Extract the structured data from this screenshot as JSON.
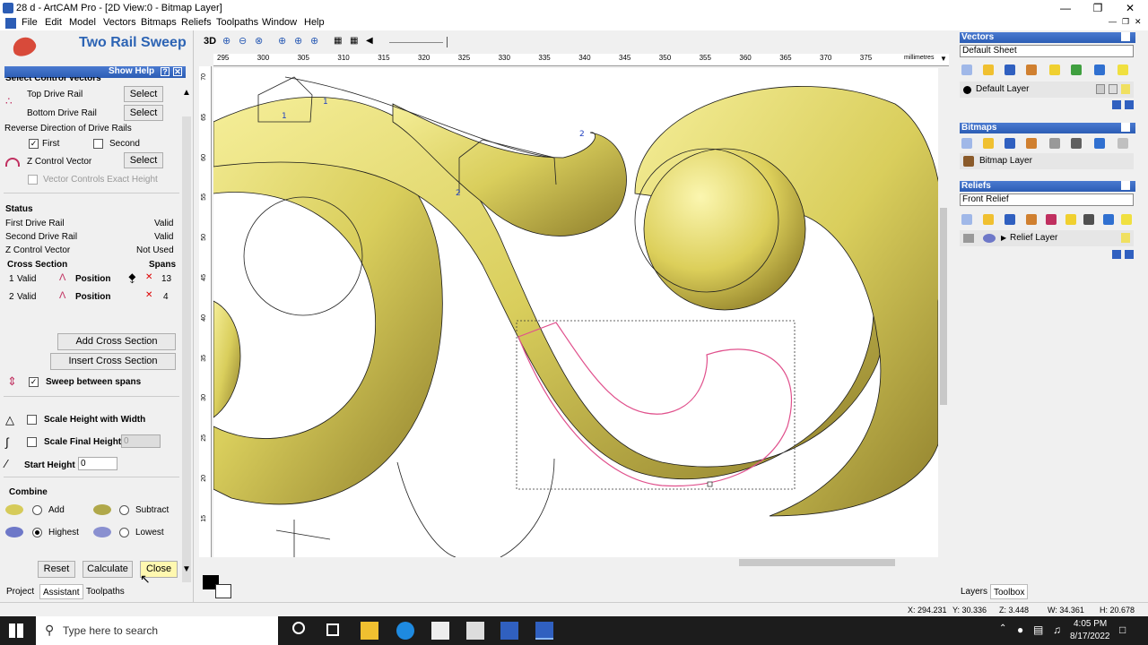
{
  "window": {
    "title": "28 d - ArtCAM Pro - [2D View:0 - Bitmap Layer]"
  },
  "menu": [
    "File",
    "Edit",
    "Model",
    "Vectors",
    "Bitmaps",
    "Reliefs",
    "Toolpaths",
    "Window",
    "Help"
  ],
  "left_panel": {
    "title": "Two Rail Sweep",
    "show_help": "Show Help",
    "section_cut": "Select Control Vectors",
    "top_drive_rail": "Top Drive Rail",
    "bottom_drive_rail": "Bottom Drive Rail",
    "select_label": "Select",
    "reverse_direction": "Reverse Direction of Drive Rails",
    "first": "First",
    "second": "Second",
    "z_control_vector": "Z Control Vector",
    "vector_controls_height": "Vector Controls Exact Height",
    "status_heading": "Status",
    "status_rows": [
      {
        "label": "First Drive Rail",
        "value": "Valid"
      },
      {
        "label": "Second Drive Rail",
        "value": "Valid"
      },
      {
        "label": "Z Control Vector",
        "value": "Not Used"
      }
    ],
    "cross_section": "Cross Section",
    "spans": "Spans",
    "cs_rows": [
      {
        "num": "1",
        "state": "Valid",
        "type": "Position",
        "spans": "13"
      },
      {
        "num": "2",
        "state": "Valid",
        "type": "Position",
        "spans": "4"
      }
    ],
    "add_cross_section": "Add Cross Section",
    "insert_cross_section": "Insert Cross Section",
    "sweep_between_spans": "Sweep between spans",
    "scale_height_with_width": "Scale Height with Width",
    "scale_final_height": "Scale Final Height",
    "scale_final_height_value": "0",
    "start_height": "Start Height",
    "start_height_value": "0",
    "combine": "Combine",
    "add": "Add",
    "subtract": "Subtract",
    "highest": "Highest",
    "lowest": "Lowest",
    "reset": "Reset",
    "calculate": "Calculate",
    "close": "Close",
    "tabs": [
      "Project",
      "Assistant",
      "Toolpaths"
    ]
  },
  "view_toolbar": {
    "mode_3d": "3D"
  },
  "ruler": {
    "x_ticks": [
      "295",
      "300",
      "305",
      "310",
      "315",
      "320",
      "325",
      "330",
      "335",
      "340",
      "345",
      "350",
      "355",
      "360",
      "365",
      "370",
      "375"
    ],
    "unit": "millimetres",
    "y_ticks": [
      "70",
      "65",
      "60",
      "55",
      "50",
      "45",
      "40",
      "35",
      "30",
      "25",
      "20",
      "15"
    ]
  },
  "right_panel": {
    "vectors": "Vectors",
    "default_sheet": "Default Sheet",
    "default_layer": "Default Layer",
    "bitmaps": "Bitmaps",
    "bitmap_layer": "Bitmap Layer",
    "reliefs": "Reliefs",
    "front_relief": "Front Relief",
    "relief_layer": "Relief Layer",
    "tabs": [
      "Layers",
      "Toolbox"
    ]
  },
  "status_bar": {
    "x": "X: 294.231",
    "y": "Y: 30.336",
    "z": "Z: 3.448",
    "w": "W: 34.361",
    "h": "H: 20.678"
  },
  "taskbar": {
    "search_placeholder": "Type here to search",
    "time": "4:05 PM",
    "date": "8/17/2022"
  },
  "colors": {
    "accent": "#2d64b4",
    "relief_gold": "#d6cb5a",
    "selection_magenta": "#e0508c"
  }
}
